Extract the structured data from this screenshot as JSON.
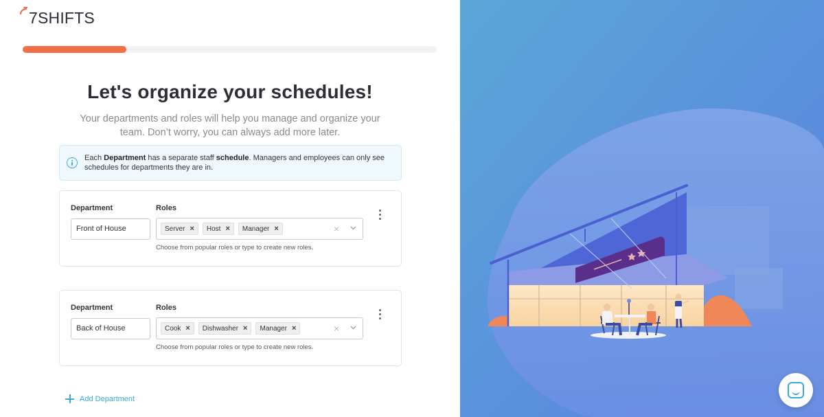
{
  "logo": {
    "text": "7SHIFTS"
  },
  "progress": {
    "fraction": 0.25
  },
  "page": {
    "title": "Let's organize your schedules!",
    "subtitle": "Your departments and roles will help you manage and organize your team. Don’t worry, you can always add more later."
  },
  "info": {
    "t1": "Each ",
    "b1": "Department",
    "t2": " has a separate staff ",
    "b2": "schedule",
    "t3": ". Managers and employees can only see schedules for departments they are in."
  },
  "departments": [
    {
      "department_label": "Department",
      "roles_label": "Roles",
      "name": "Front of House",
      "roles": [
        "Server",
        "Host",
        "Manager"
      ],
      "hint": "Choose from popular roles or type to create new roles."
    },
    {
      "department_label": "Department",
      "roles_label": "Roles",
      "name": "Back of House",
      "roles": [
        "Cook",
        "Dishwasher",
        "Manager"
      ],
      "hint": "Choose from popular roles or type to create new roles."
    }
  ],
  "actions": {
    "add_department": "Add Department"
  },
  "colors": {
    "accent": "#f26f45",
    "link": "#3aa8d8",
    "panel_bg": "#5b8fdc"
  }
}
